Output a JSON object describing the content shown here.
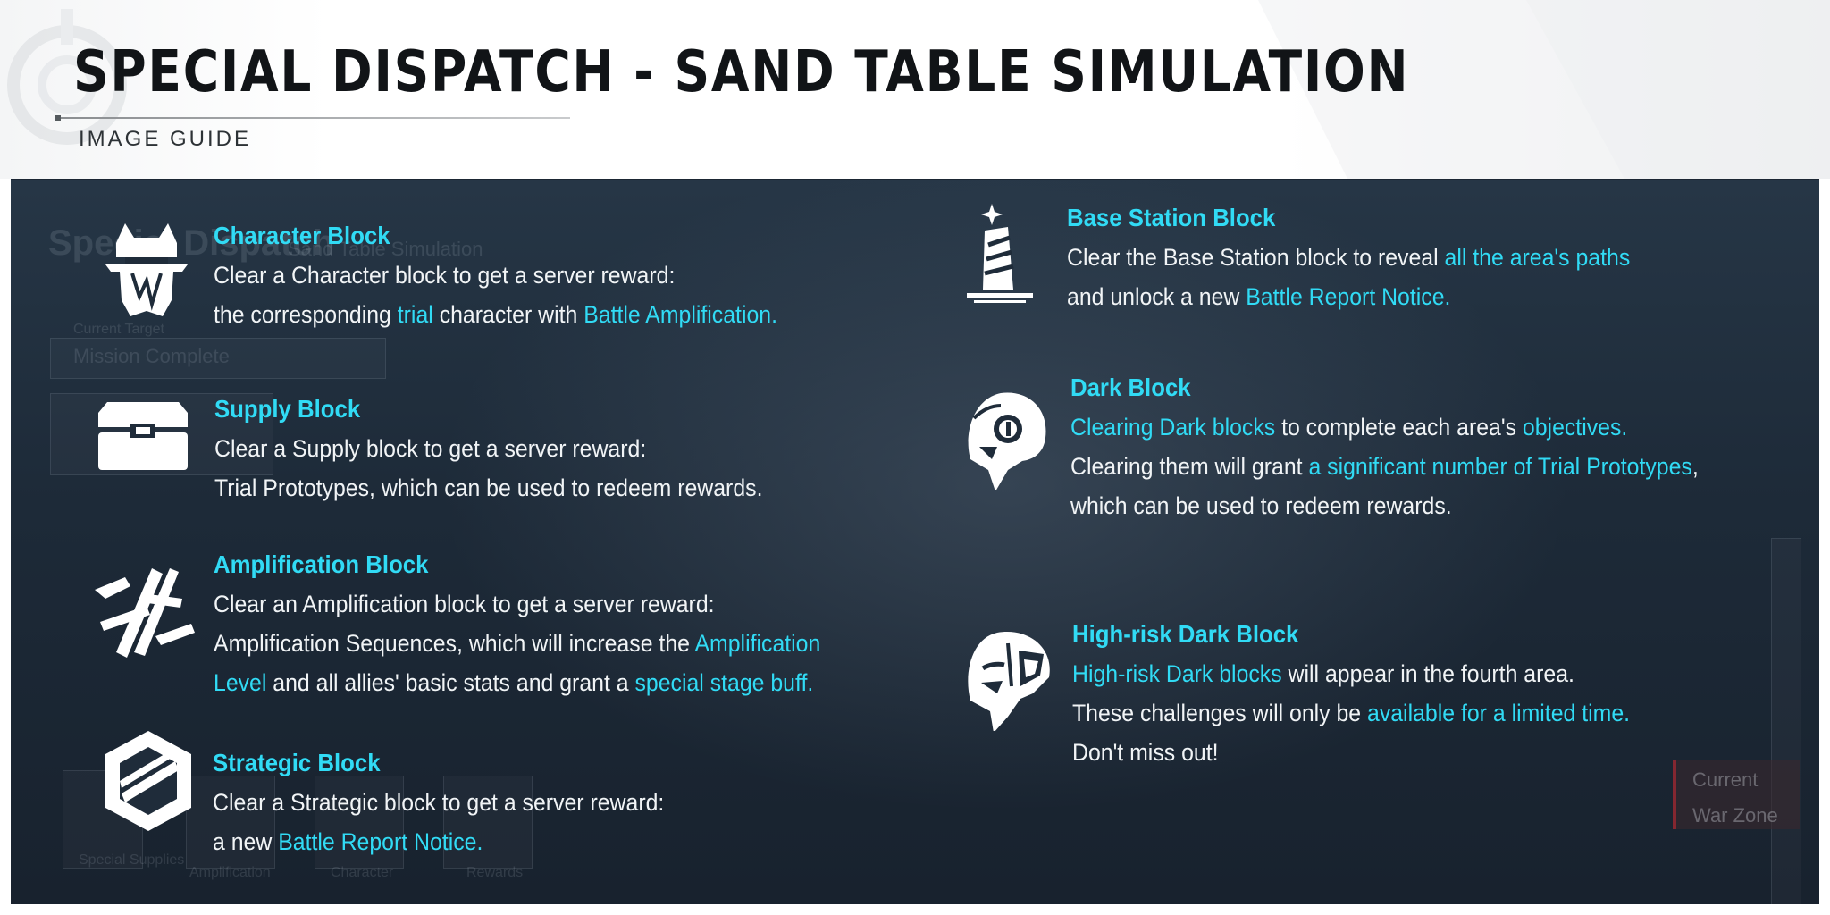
{
  "header": {
    "title": "SPECIAL DISPATCH - SAND TABLE SIMULATION",
    "subtitle": "IMAGE GUIDE"
  },
  "colors": {
    "accent": "#31dbf5",
    "body_text": "#f1f4f6",
    "panel_bg": "#1f2c3a",
    "title_text": "#111417"
  },
  "blocks": {
    "character": {
      "icon": "character-block-icon",
      "name": "Character Block",
      "l1": "Clear a Character block to get a server reward:",
      "l2a": "the corresponding ",
      "l2b": "trial",
      "l2c": " character with ",
      "l2d": "Battle Amplification."
    },
    "supply": {
      "icon": "supply-block-icon",
      "name": "Supply Block",
      "l1": "Clear a Supply block to get a server reward:",
      "l2": "Trial Prototypes, which can be used to redeem rewards."
    },
    "amplification": {
      "icon": "amplification-block-icon",
      "name": "Amplification Block",
      "l1": "Clear an Amplification block to get a server reward:",
      "l2a": "Amplification Sequences, which will increase the ",
      "l2b": "Amplification",
      "l3a": "Level",
      "l3b": " and all allies' basic stats and grant a ",
      "l3c": "special stage buff."
    },
    "strategic": {
      "icon": "strategic-block-icon",
      "name": "Strategic Block",
      "l1": "Clear a Strategic block to get a server reward:",
      "l2a": "a new ",
      "l2b": "Battle Report Notice."
    },
    "base_station": {
      "icon": "base-station-block-icon",
      "name": "Base Station Block",
      "l1a": "Clear the Base Station block to reveal ",
      "l1b": "all the area's paths",
      "l2a": "and unlock a new ",
      "l2b": "Battle Report Notice."
    },
    "dark": {
      "icon": "dark-block-icon",
      "name": "Dark Block",
      "l1a": "Clearing Dark blocks",
      "l1b": " to complete each area's ",
      "l1c": "objectives.",
      "l2a": "Clearing them will grant ",
      "l2b": "a significant number of Trial Prototypes",
      "l2c": ",",
      "l3": "which can be used to redeem rewards."
    },
    "high_risk": {
      "icon": "high-risk-dark-block-icon",
      "name": "High-risk Dark Block",
      "l1a": "High-risk Dark blocks",
      "l1b": " will appear in the fourth area.",
      "l2a": "These challenges will only be ",
      "l2b": "available for a limited time.",
      "l3": "Don't miss out!"
    }
  },
  "background_ui": {
    "page_title": "Special Dispatch",
    "page_subtitle": "Sand Table Simulation",
    "current_target_label": "Current Target",
    "current_target_value": "Mission Complete",
    "bottom_tabs": [
      "Special Supplies",
      "Amplification",
      "Character",
      "Rewards"
    ],
    "current_war_zone": [
      "Current",
      "War Zone"
    ]
  }
}
